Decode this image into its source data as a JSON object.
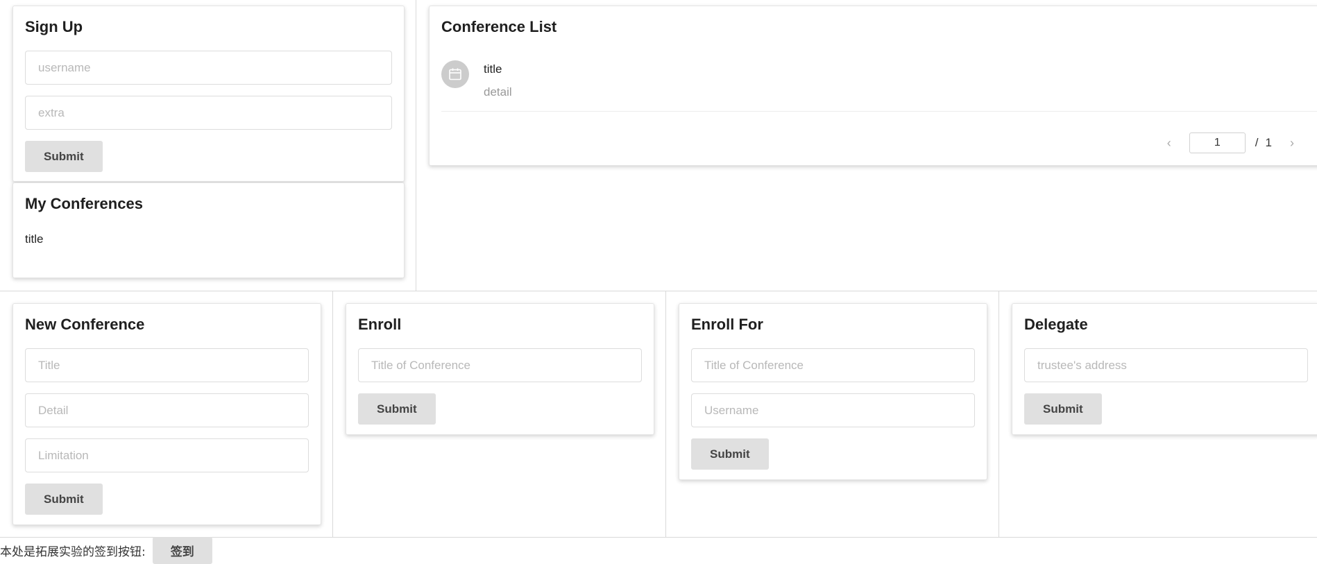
{
  "signup": {
    "title": "Sign Up",
    "username_placeholder": "username",
    "extra_placeholder": "extra",
    "submit_label": "Submit"
  },
  "my_conferences": {
    "title": "My Conferences",
    "items": [
      "title"
    ]
  },
  "conference_list": {
    "title": "Conference List",
    "items": [
      {
        "title": "title",
        "detail": "detail",
        "icon": "calendar-icon"
      }
    ],
    "pagination": {
      "prev_icon": "chevron-left-icon",
      "current_page": "1",
      "separator": "/",
      "total_pages": "1",
      "next_icon": "chevron-right-icon"
    }
  },
  "new_conference": {
    "title": "New Conference",
    "title_placeholder": "Title",
    "detail_placeholder": "Detail",
    "limitation_placeholder": "Limitation",
    "submit_label": "Submit"
  },
  "enroll": {
    "title": "Enroll",
    "conference_placeholder": "Title of Conference",
    "submit_label": "Submit"
  },
  "enroll_for": {
    "title": "Enroll For",
    "conference_placeholder": "Title of Conference",
    "username_placeholder": "Username",
    "submit_label": "Submit"
  },
  "delegate": {
    "title": "Delegate",
    "address_placeholder": "trustee's address",
    "submit_label": "Submit"
  },
  "footer": {
    "label": "本处是拓展实验的签到按钮:",
    "checkin_label": "签到"
  },
  "colors": {
    "button_bg": "#e0e0e0",
    "divider": "#d9d9d9",
    "avatar_bg": "#cccccc"
  }
}
